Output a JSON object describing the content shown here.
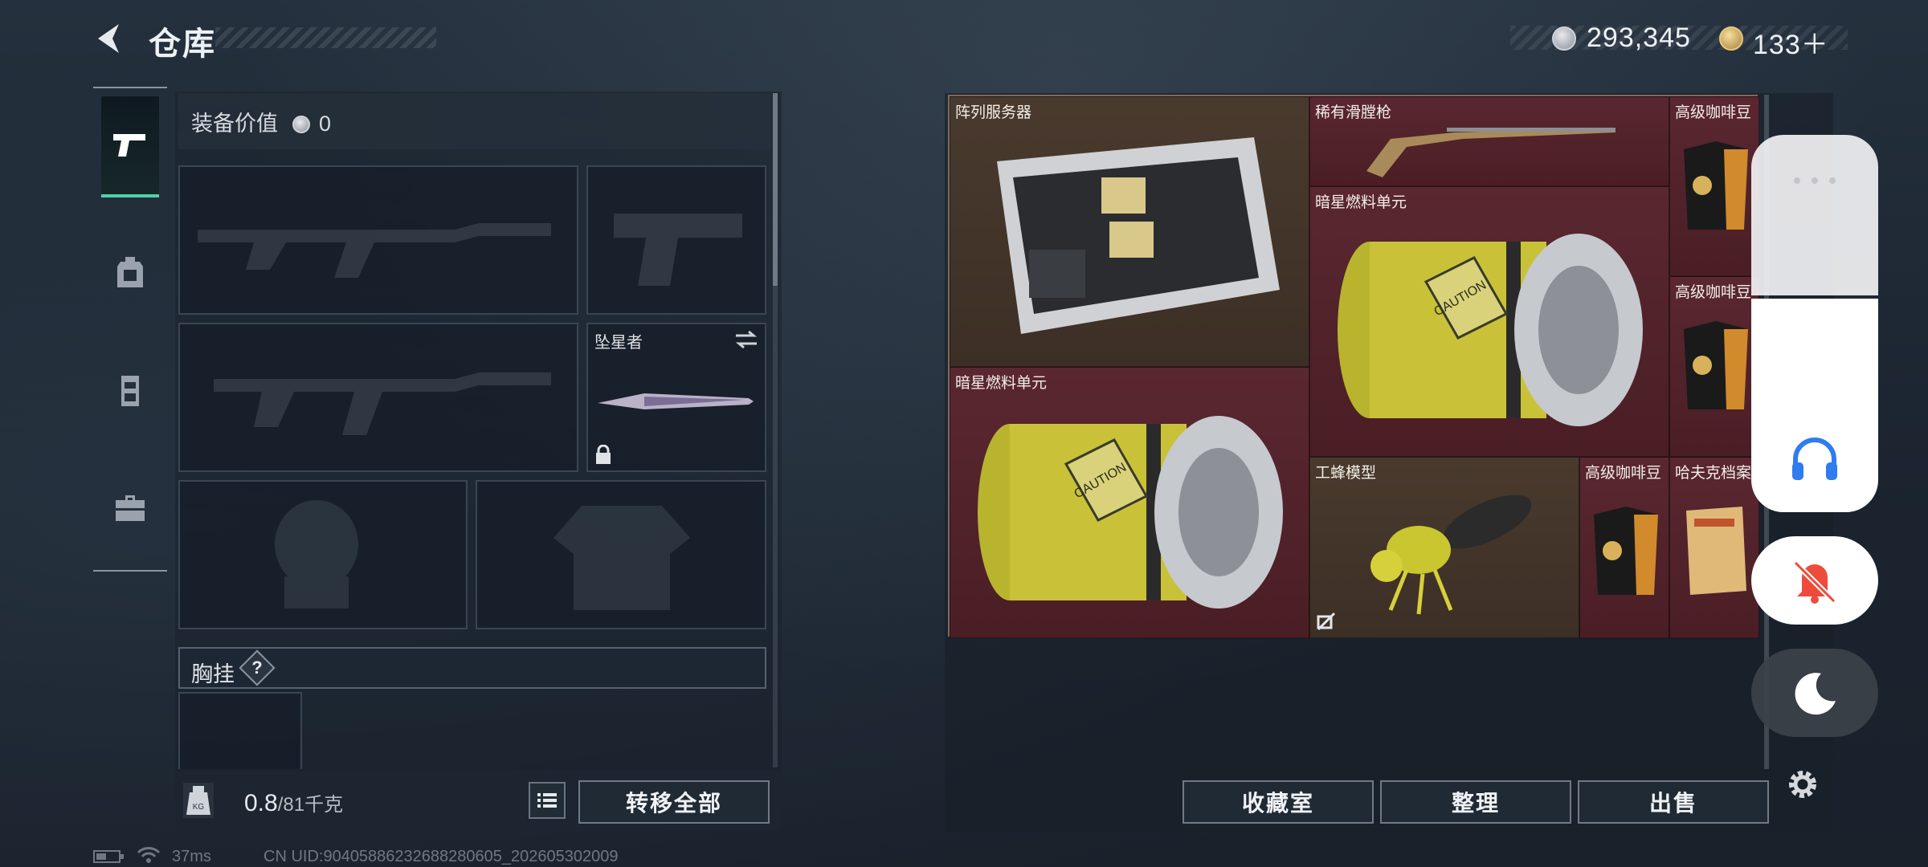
{
  "header": {
    "title": "仓库",
    "currency_silver": "293,345",
    "currency_gold": "133＋"
  },
  "sidebar": {
    "tabs": [
      {
        "name": "weapons",
        "icon": "pistol-icon",
        "active": true
      },
      {
        "name": "backpack",
        "icon": "backpack-icon",
        "active": false
      },
      {
        "name": "rig",
        "icon": "locker-icon",
        "active": false
      },
      {
        "name": "case",
        "icon": "briefcase-icon",
        "active": false
      }
    ]
  },
  "equipment": {
    "value_label": "装备价值",
    "value": "0",
    "melee_slot_name": "坠星者",
    "chest_label": "胸挂",
    "chest_help": "?"
  },
  "footer_left": {
    "weight_current": "0.8",
    "weight_max": "/81千克",
    "kg_icon_label": "KG",
    "transfer_all": "转移全部"
  },
  "stash": {
    "items": [
      {
        "id": "server",
        "name": "阵列服务器",
        "color": "brown"
      },
      {
        "id": "musket",
        "name": "稀有滑膛枪",
        "color": "red"
      },
      {
        "id": "coffee1",
        "name": "高级咖啡豆",
        "color": "red"
      },
      {
        "id": "fuel1",
        "name": "暗星燃料单元",
        "color": "red"
      },
      {
        "id": "coffee2",
        "name": "高级咖啡豆",
        "color": "red"
      },
      {
        "id": "fuel2",
        "name": "暗星燃料单元",
        "color": "red"
      },
      {
        "id": "wasp",
        "name": "工蜂模型",
        "color": "brown"
      },
      {
        "id": "coffee3",
        "name": "高级咖啡豆",
        "color": "red"
      },
      {
        "id": "dossier",
        "name": "哈夫克档案",
        "color": "red"
      }
    ],
    "fuel_label": "CAUTION",
    "buttons": {
      "collection": "收藏室",
      "sort": "整理",
      "sell": "出售"
    }
  },
  "status_bar": {
    "ping": "37ms",
    "uid": "CN UID:9040588623268828060​5_202605302009"
  },
  "colors": {
    "accent": "#4fd1a6",
    "rare_red": "#4e2228",
    "epic_brown": "#4a3a2e"
  }
}
